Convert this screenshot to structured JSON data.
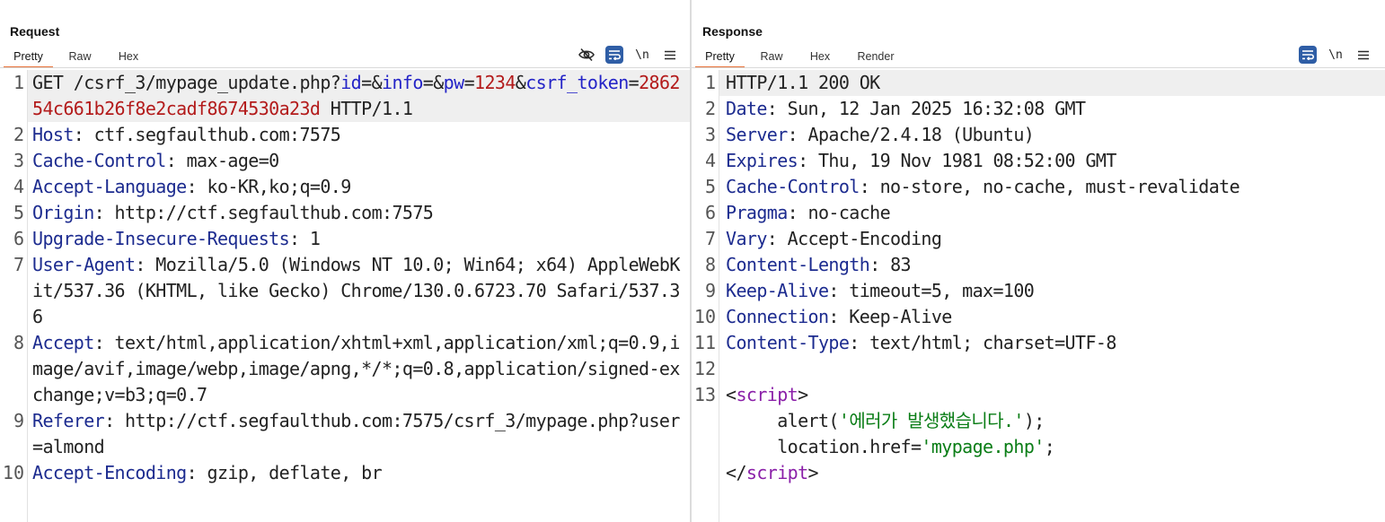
{
  "layout_toggle": [
    {
      "name": "side-by-side",
      "active": true
    },
    {
      "name": "stacked",
      "active": false
    },
    {
      "name": "single",
      "active": false
    }
  ],
  "request": {
    "title": "Request",
    "tabs": [
      "Pretty",
      "Raw",
      "Hex"
    ],
    "active_tab": "Pretty",
    "tools": {
      "newline_label": "\\n"
    },
    "lines": [
      {
        "num": "1",
        "parts": [
          {
            "t": "GET /csrf_3/mypage_update.php?",
            "c": ""
          },
          {
            "t": "id",
            "c": "pk"
          },
          {
            "t": "=&",
            "c": ""
          },
          {
            "t": "info",
            "c": "pk"
          },
          {
            "t": "=&",
            "c": ""
          },
          {
            "t": "pw",
            "c": "pk"
          },
          {
            "t": "=",
            "c": ""
          },
          {
            "t": "1234",
            "c": "pv"
          },
          {
            "t": "&",
            "c": ""
          },
          {
            "t": "csrf_token",
            "c": "pk"
          },
          {
            "t": "=",
            "c": ""
          },
          {
            "t": "286254c661b26f8e2cadf8674530a23d",
            "c": "pv"
          },
          {
            "t": " HTTP/1.1",
            "c": ""
          }
        ]
      },
      {
        "num": "2",
        "parts": [
          {
            "t": "Host",
            "c": "k"
          },
          {
            "t": ": ctf.segfaulthub.com:7575",
            "c": ""
          }
        ]
      },
      {
        "num": "3",
        "parts": [
          {
            "t": "Cache-Control",
            "c": "k"
          },
          {
            "t": ": max-age=0",
            "c": ""
          }
        ]
      },
      {
        "num": "4",
        "parts": [
          {
            "t": "Accept-Language",
            "c": "k"
          },
          {
            "t": ": ko-KR,ko;q=0.9",
            "c": ""
          }
        ]
      },
      {
        "num": "5",
        "parts": [
          {
            "t": "Origin",
            "c": "k"
          },
          {
            "t": ": http://ctf.segfaulthub.com:7575",
            "c": ""
          }
        ]
      },
      {
        "num": "6",
        "parts": [
          {
            "t": "Upgrade-Insecure-Requests",
            "c": "k"
          },
          {
            "t": ": 1",
            "c": ""
          }
        ]
      },
      {
        "num": "7",
        "parts": [
          {
            "t": "User-Agent",
            "c": "k"
          },
          {
            "t": ": Mozilla/5.0 (Windows NT 10.0; Win64; x64) AppleWebKit/537.36 (KHTML, like Gecko) Chrome/130.0.6723.70 Safari/537.36",
            "c": ""
          }
        ]
      },
      {
        "num": "8",
        "parts": [
          {
            "t": "Accept",
            "c": "k"
          },
          {
            "t": ": text/html,application/xhtml+xml,application/xml;q=0.9,image/avif,image/webp,image/apng,*/*;q=0.8,application/signed-exchange;v=b3;q=0.7",
            "c": ""
          }
        ]
      },
      {
        "num": "9",
        "parts": [
          {
            "t": "Referer",
            "c": "k"
          },
          {
            "t": ": http://ctf.segfaulthub.com:7575/csrf_3/mypage.php?user=almond",
            "c": ""
          }
        ]
      },
      {
        "num": "10",
        "parts": [
          {
            "t": "Accept-Encoding",
            "c": "k"
          },
          {
            "t": ": gzip, deflate, br",
            "c": ""
          }
        ]
      }
    ]
  },
  "response": {
    "title": "Response",
    "tabs": [
      "Pretty",
      "Raw",
      "Hex",
      "Render"
    ],
    "active_tab": "Pretty",
    "tools": {
      "newline_label": "\\n"
    },
    "lines": [
      {
        "num": "1",
        "parts": [
          {
            "t": "HTTP/1.1 200 OK",
            "c": ""
          }
        ]
      },
      {
        "num": "2",
        "parts": [
          {
            "t": "Date",
            "c": "k"
          },
          {
            "t": ": Sun, 12 Jan 2025 16:32:08 GMT",
            "c": ""
          }
        ]
      },
      {
        "num": "3",
        "parts": [
          {
            "t": "Server",
            "c": "k"
          },
          {
            "t": ": Apache/2.4.18 (Ubuntu)",
            "c": ""
          }
        ]
      },
      {
        "num": "4",
        "parts": [
          {
            "t": "Expires",
            "c": "k"
          },
          {
            "t": ": Thu, 19 Nov 1981 08:52:00 GMT",
            "c": ""
          }
        ]
      },
      {
        "num": "5",
        "parts": [
          {
            "t": "Cache-Control",
            "c": "k"
          },
          {
            "t": ": no-store, no-cache, must-revalidate",
            "c": ""
          }
        ]
      },
      {
        "num": "6",
        "parts": [
          {
            "t": "Pragma",
            "c": "k"
          },
          {
            "t": ": no-cache",
            "c": ""
          }
        ]
      },
      {
        "num": "7",
        "parts": [
          {
            "t": "Vary",
            "c": "k"
          },
          {
            "t": ": Accept-Encoding",
            "c": ""
          }
        ]
      },
      {
        "num": "8",
        "parts": [
          {
            "t": "Content-Length",
            "c": "k"
          },
          {
            "t": ": 83",
            "c": ""
          }
        ]
      },
      {
        "num": "9",
        "parts": [
          {
            "t": "Keep-Alive",
            "c": "k"
          },
          {
            "t": ": timeout=5, max=100",
            "c": ""
          }
        ]
      },
      {
        "num": "10",
        "parts": [
          {
            "t": "Connection",
            "c": "k"
          },
          {
            "t": ": Keep-Alive",
            "c": ""
          }
        ]
      },
      {
        "num": "11",
        "parts": [
          {
            "t": "Content-Type",
            "c": "k"
          },
          {
            "t": ": text/html; charset=UTF-8",
            "c": ""
          }
        ]
      },
      {
        "num": "12",
        "parts": [
          {
            "t": "",
            "c": ""
          }
        ]
      },
      {
        "num": "13",
        "parts": [
          {
            "t": "<",
            "c": ""
          },
          {
            "t": "script",
            "c": "tg"
          },
          {
            "t": ">\n     alert(",
            "c": ""
          },
          {
            "t": "'에러가 발생했습니다.'",
            "c": "str"
          },
          {
            "t": ");\n     location.href=",
            "c": ""
          },
          {
            "t": "'mypage.php'",
            "c": "str"
          },
          {
            "t": ";\n</",
            "c": ""
          },
          {
            "t": "script",
            "c": "tg"
          },
          {
            "t": ">",
            "c": ""
          }
        ]
      }
    ]
  }
}
